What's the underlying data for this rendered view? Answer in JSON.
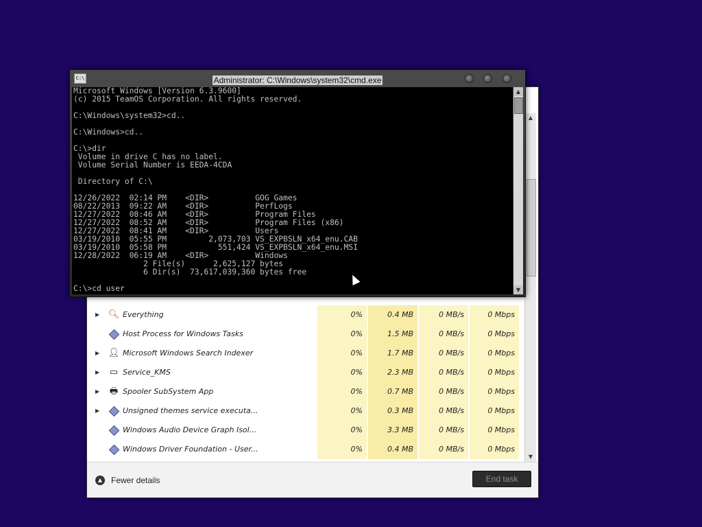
{
  "task_manager": {
    "rows": [
      {
        "name": "Everything",
        "icon": "magnifier-icon",
        "expand": true,
        "cpu": "0%",
        "memory": "0.4 MB",
        "disk": "0 MB/s",
        "network": "0 Mbps"
      },
      {
        "name": "Host Process for Windows Tasks",
        "icon": "service-icon",
        "expand": false,
        "cpu": "0%",
        "memory": "1.5 MB",
        "disk": "0 MB/s",
        "network": "0 Mbps"
      },
      {
        "name": "Microsoft Windows Search Indexer",
        "icon": "user-icon",
        "expand": true,
        "cpu": "0%",
        "memory": "1.7 MB",
        "disk": "0 MB/s",
        "network": "0 Mbps"
      },
      {
        "name": "Service_KMS",
        "icon": "window-icon",
        "expand": true,
        "cpu": "0%",
        "memory": "2.3 MB",
        "disk": "0 MB/s",
        "network": "0 Mbps"
      },
      {
        "name": "Spooler SubSystem App",
        "icon": "printer-icon",
        "expand": true,
        "cpu": "0%",
        "memory": "0.7 MB",
        "disk": "0 MB/s",
        "network": "0 Mbps"
      },
      {
        "name": "Unsigned themes service executa...",
        "icon": "service-icon",
        "expand": true,
        "cpu": "0%",
        "memory": "0.3 MB",
        "disk": "0 MB/s",
        "network": "0 Mbps"
      },
      {
        "name": "Windows Audio Device Graph Isol...",
        "icon": "service-icon",
        "expand": false,
        "cpu": "0%",
        "memory": "3.3 MB",
        "disk": "0 MB/s",
        "network": "0 Mbps"
      },
      {
        "name": "Windows Driver Foundation - User...",
        "icon": "service-icon",
        "expand": false,
        "cpu": "0%",
        "memory": "0.4 MB",
        "disk": "0 MB/s",
        "network": "0 Mbps"
      }
    ],
    "fewer_details_label": "Fewer details",
    "end_task_label": "End task"
  },
  "cmd": {
    "title": "Administrator: C:\\Windows\\system32\\cmd.exe",
    "lines": [
      "Microsoft Windows [Version 6.3.9600]",
      "(c) 2015 TeamOS Corporation. All rights reserved.",
      "",
      "C:\\Windows\\system32>cd..",
      "",
      "C:\\Windows>cd..",
      "",
      "C:\\>dir",
      " Volume in drive C has no label.",
      " Volume Serial Number is EEDA-4CDA",
      "",
      " Directory of C:\\",
      "",
      "12/26/2022  02:14 PM    <DIR>          GOG Games",
      "08/22/2013  09:22 AM    <DIR>          PerfLogs",
      "12/27/2022  08:46 AM    <DIR>          Program Files",
      "12/27/2022  08:52 AM    <DIR>          Program Files (x86)",
      "12/27/2022  08:41 AM    <DIR>          Users",
      "03/19/2010  05:55 PM         2,073,703 VS_EXPBSLN_x64_enu.CAB",
      "03/19/2010  05:58 PM           551,424 VS_EXPBSLN_x64_enu.MSI",
      "12/28/2022  06:19 AM    <DIR>          Windows",
      "               2 File(s)      2,625,127 bytes",
      "               6 Dir(s)  73,617,039,360 bytes free",
      "",
      "C:\\>cd user"
    ]
  }
}
